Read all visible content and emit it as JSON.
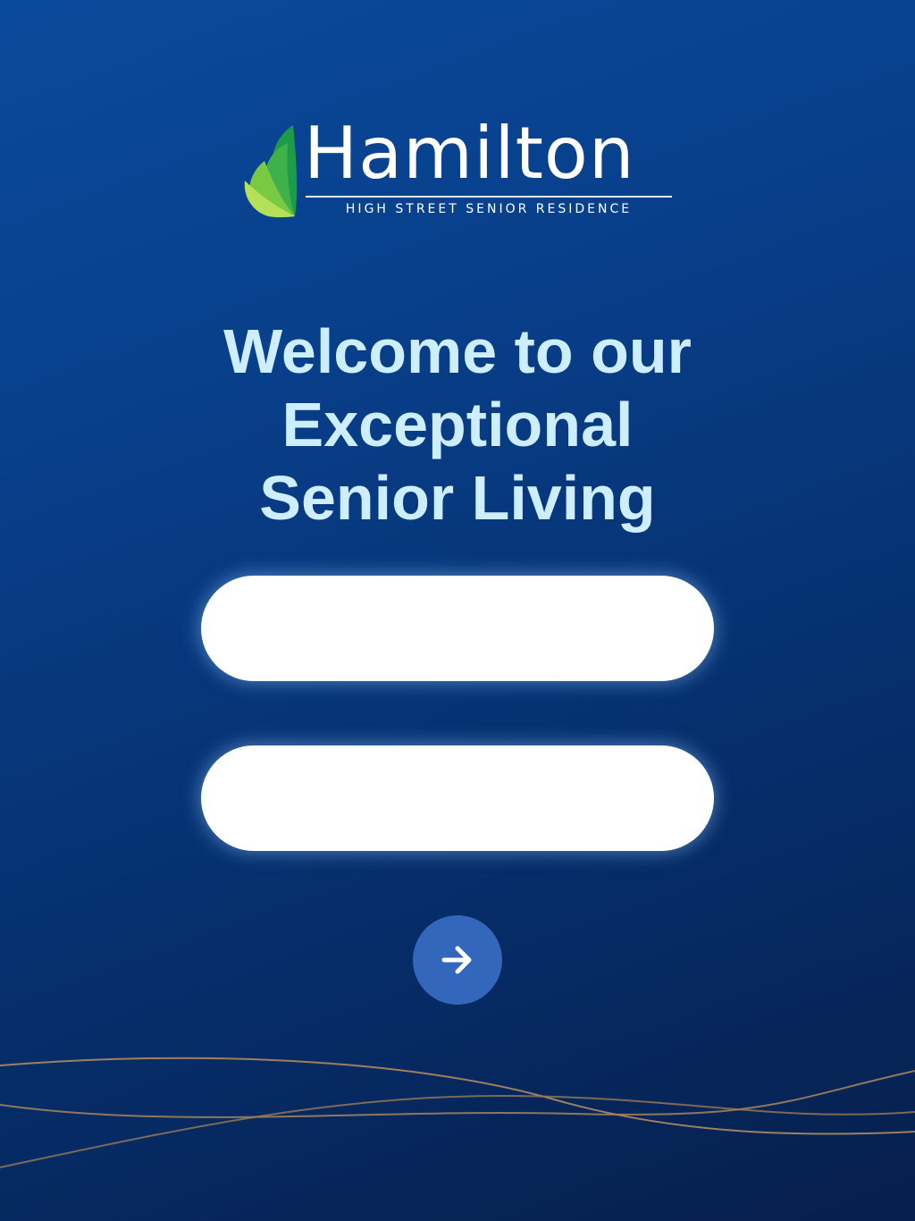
{
  "brand": {
    "name": "Hamilton",
    "tagline": "HIGH STREET SENIOR RESIDENCE",
    "leaf_colors": [
      "#7ac943",
      "#3fb04a",
      "#1e9b48",
      "#b6df5a"
    ]
  },
  "welcome": {
    "lines": [
      "Welcome to our",
      "Exceptional",
      "Senior Living"
    ]
  },
  "form": {
    "field_1": {
      "value": "",
      "placeholder": ""
    },
    "field_2": {
      "value": "",
      "placeholder": ""
    },
    "submit_icon": "arrow-right-icon"
  },
  "colors": {
    "background_top": "#0a4a9c",
    "background_bottom": "#061f4c",
    "headline": "#cdeefe",
    "button": "#3267bb",
    "wave_line": "#b08a5e"
  }
}
